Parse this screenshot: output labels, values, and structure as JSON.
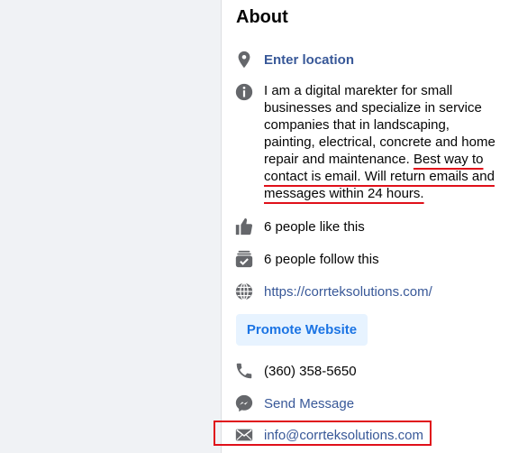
{
  "about": {
    "title": "About",
    "location_label": "Enter location",
    "description_plain": "I am a digital marekter for small businesses and specialize in service companies that in landscaping, painting, electrical, concrete and home repair and maintenance. ",
    "description_highlight": "Best way to contact is email. Will return emails and messages within 24 hours.",
    "likes": "6 people like this",
    "follows": "6 people follow this",
    "website": "https://corrteksolutions.com/",
    "promote_label": "Promote Website",
    "phone": "(360) 358-5650",
    "message_label": "Send Message",
    "email": "info@corrteksolutions.com"
  },
  "icons": [
    "location-pin-icon",
    "info-icon",
    "thumbs-up-icon",
    "follow-icon",
    "globe-icon",
    "phone-icon",
    "messenger-icon",
    "envelope-icon"
  ],
  "colors": {
    "link": "#385898",
    "icon": "#65676b",
    "highlight": "#e0101a",
    "button_bg": "#e7f3ff",
    "button_text": "#1b74e4"
  }
}
